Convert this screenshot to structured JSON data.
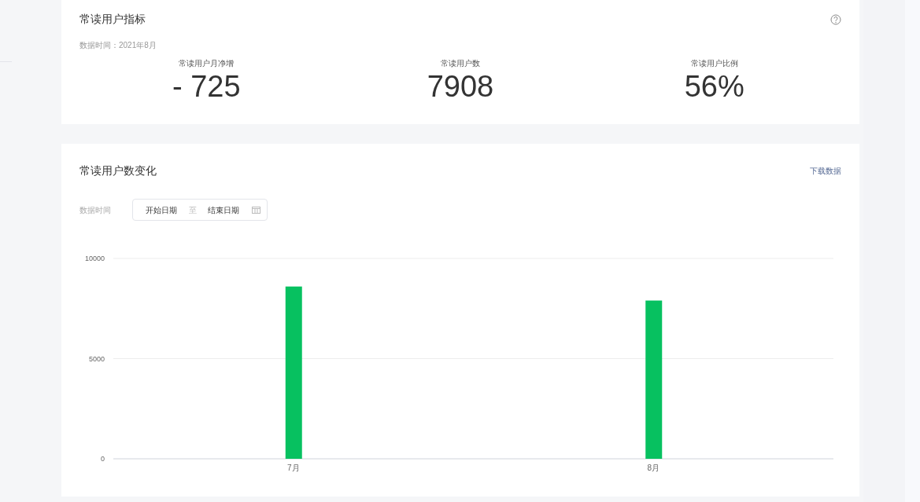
{
  "metrics_card": {
    "title": "常读用户指标",
    "data_time": "数据时间：2021年8月",
    "metrics": [
      {
        "label": "常读用户月净增",
        "value": "- 725"
      },
      {
        "label": "常读用户数",
        "value": "7908"
      },
      {
        "label": "常读用户比例",
        "value": "56%"
      }
    ]
  },
  "trend_card": {
    "title": "常读用户数变化",
    "download_link": "下载数据",
    "date_filter": {
      "label": "数据时间",
      "start_placeholder": "开始日期",
      "separator": "至",
      "end_placeholder": "结束日期"
    },
    "chart_data": {
      "type": "bar",
      "categories": [
        "7月",
        "8月"
      ],
      "series": [
        {
          "color": "#07c160",
          "values": [
            8600,
            7900
          ]
        }
      ],
      "ylim": [
        0,
        10000
      ],
      "yticks": [
        0,
        5000,
        10000
      ]
    }
  }
}
